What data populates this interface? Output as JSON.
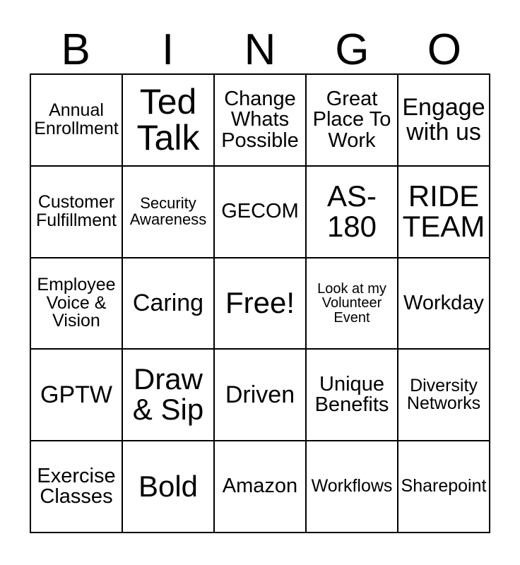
{
  "card": {
    "header_letters": [
      "B",
      "I",
      "N",
      "G",
      "O"
    ],
    "colors": {
      "background": "#ffffff",
      "text": "#000000",
      "grid_line": "#000000"
    },
    "grid": {
      "columns": 5,
      "rows": 5,
      "free_space_label": "Free!",
      "free_space_position": "row3-col3"
    },
    "cells": [
      [
        {
          "text": "Annual Enrollment",
          "size": "sm"
        },
        {
          "text": "Ted Talk",
          "size": "xxl"
        },
        {
          "text": "Change Whats Possible",
          "size": "md"
        },
        {
          "text": "Great Place To Work",
          "size": "md"
        },
        {
          "text": "Engage with us",
          "size": "lg"
        }
      ],
      [
        {
          "text": "Customer Fulfillment",
          "size": "sm"
        },
        {
          "text": "Security Awareness",
          "size": "xs"
        },
        {
          "text": "GECOM",
          "size": "md"
        },
        {
          "text": "AS-180",
          "size": "xl"
        },
        {
          "text": "RIDE TEAM",
          "size": "xl"
        }
      ],
      [
        {
          "text": "Employee Voice & Vision",
          "size": "sm"
        },
        {
          "text": "Caring",
          "size": "lg"
        },
        {
          "text": "Free!",
          "size": "xl"
        },
        {
          "text": "Look at my Volunteer Event",
          "size": "xxs"
        },
        {
          "text": "Workday",
          "size": "md"
        }
      ],
      [
        {
          "text": "GPTW",
          "size": "lg"
        },
        {
          "text": "Draw & Sip",
          "size": "xl"
        },
        {
          "text": "Driven",
          "size": "lg"
        },
        {
          "text": "Unique Benefits",
          "size": "md"
        },
        {
          "text": "Diversity Networks",
          "size": "sm"
        }
      ],
      [
        {
          "text": "Exercise Classes",
          "size": "md"
        },
        {
          "text": "Bold",
          "size": "xl"
        },
        {
          "text": "Amazon",
          "size": "md"
        },
        {
          "text": "Workflows",
          "size": "sm"
        },
        {
          "text": "Sharepoint",
          "size": "sm"
        }
      ]
    ]
  }
}
